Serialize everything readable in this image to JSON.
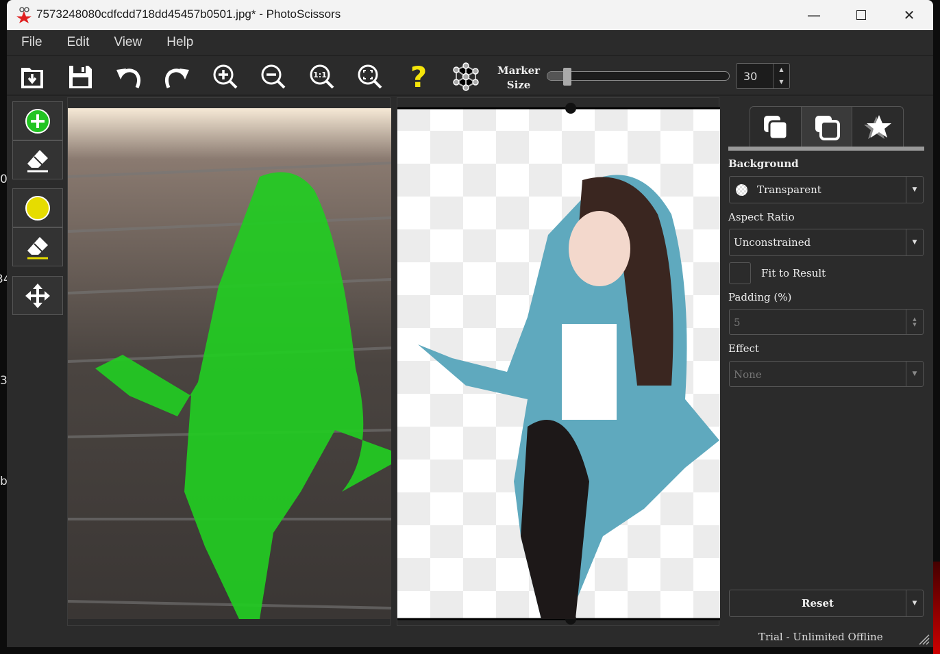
{
  "desktop_fragments": [
    "0.",
    "34",
    "3",
    "b"
  ],
  "window": {
    "title": "7573248080cdfcdd718dd45457b0501.jpg* - PhotoScissors",
    "minimize": "—",
    "maximize": "☐",
    "close": "✕"
  },
  "menu": [
    "File",
    "Edit",
    "View",
    "Help"
  ],
  "toolbar": {
    "buttons": [
      "open-icon",
      "save-icon",
      "undo-icon",
      "redo-icon",
      "zoom-in-icon",
      "zoom-out-icon",
      "zoom-actual-icon",
      "zoom-fit-icon",
      "help-icon",
      "neural-network-icon"
    ],
    "marker_label_1": "Marker",
    "marker_label_2": "Size",
    "marker_size": "30",
    "marker_slider_percent": 3
  },
  "tools": [
    "add-foreground-marker",
    "erase-foreground-marker",
    "background-marker",
    "erase-background-marker",
    "move-tool"
  ],
  "panel": {
    "tabs": [
      "background-tab",
      "foreground-tab",
      "effects-tab"
    ],
    "background_label": "Background",
    "background_value": "Transparent",
    "aspect_label": "Aspect Ratio",
    "aspect_value": "Unconstrained",
    "fit_label": "Fit to Result",
    "fit_checked": false,
    "padding_label": "Padding (%)",
    "padding_value": "5",
    "effect_label": "Effect",
    "effect_value": "None",
    "reset_label": "Reset"
  },
  "status": "Trial - Unlimited Offline",
  "colors": {
    "accent_green": "#22c422",
    "marker_yellow": "#e6dc00",
    "help_yellow": "#f5e50a"
  }
}
